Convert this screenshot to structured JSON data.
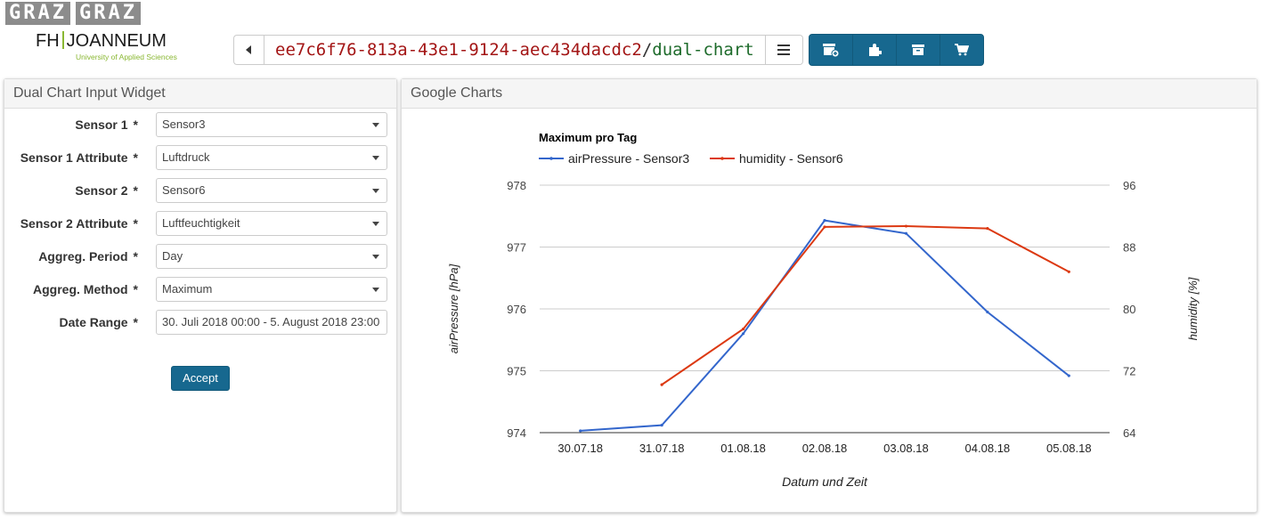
{
  "logo": {
    "graz_left": "GRAZ",
    "graz_right": "GRAZ",
    "fh": "FH",
    "joanneum": "JOANNEUM",
    "subtitle": "University of Applied Sciences"
  },
  "topbar": {
    "path_id": "ee7c6f76-813a-43e1-9124-aec434dacdc2",
    "path_sep": "/",
    "path_name": "dual-chart",
    "back_icon": "caret-left-icon",
    "menu_icon": "hamburger-menu-icon",
    "tools": [
      "add-storage-icon",
      "puzzle-icon",
      "archive-icon",
      "cart-icon"
    ]
  },
  "input_widget": {
    "title": "Dual Chart Input Widget",
    "fields": [
      {
        "label": "Sensor 1",
        "value": "Sensor3"
      },
      {
        "label": "Sensor 1 Attribute",
        "value": "Luftdruck"
      },
      {
        "label": "Sensor 2",
        "value": "Sensor6"
      },
      {
        "label": "Sensor 2 Attribute",
        "value": "Luftfeuchtigkeit"
      },
      {
        "label": "Aggreg. Period",
        "value": "Day"
      },
      {
        "label": "Aggreg. Method",
        "value": "Maximum"
      },
      {
        "label": "Date Range",
        "value": "30. Juli 2018 00:00 - 5. August 2018 23:00"
      }
    ],
    "required_mark": "*",
    "accept_label": "Accept"
  },
  "chart_panel": {
    "title": "Google Charts"
  },
  "colors": {
    "accent": "#17688f",
    "series1": "#3366cc",
    "series2": "#dc3912"
  },
  "chart_data": {
    "type": "line",
    "title": "Maximum pro Tag",
    "xlabel": "Datum und Zeit",
    "ylabel_left": "airPressure [hPa]",
    "ylabel_right": "humidity [%]",
    "categories": [
      "30.07.18",
      "31.07.18",
      "01.08.18",
      "02.08.18",
      "03.08.18",
      "04.08.18",
      "05.08.18"
    ],
    "ylim_left": [
      974,
      978
    ],
    "yticks_left": [
      "974",
      "975",
      "976",
      "977",
      "978"
    ],
    "ylim_right": [
      64,
      96
    ],
    "yticks_right": [
      "64",
      "72",
      "80",
      "88",
      "96"
    ],
    "legend_position": "top",
    "grid": true,
    "series": [
      {
        "name": "airPressure - Sensor3",
        "axis": "left",
        "values": [
          974.03,
          974.12,
          975.6,
          977.43,
          977.22,
          975.95,
          974.92
        ]
      },
      {
        "name": "humidity - Sensor6",
        "axis": "right",
        "values": [
          null,
          70.2,
          77.4,
          90.6,
          90.7,
          90.4,
          84.8
        ]
      }
    ]
  }
}
